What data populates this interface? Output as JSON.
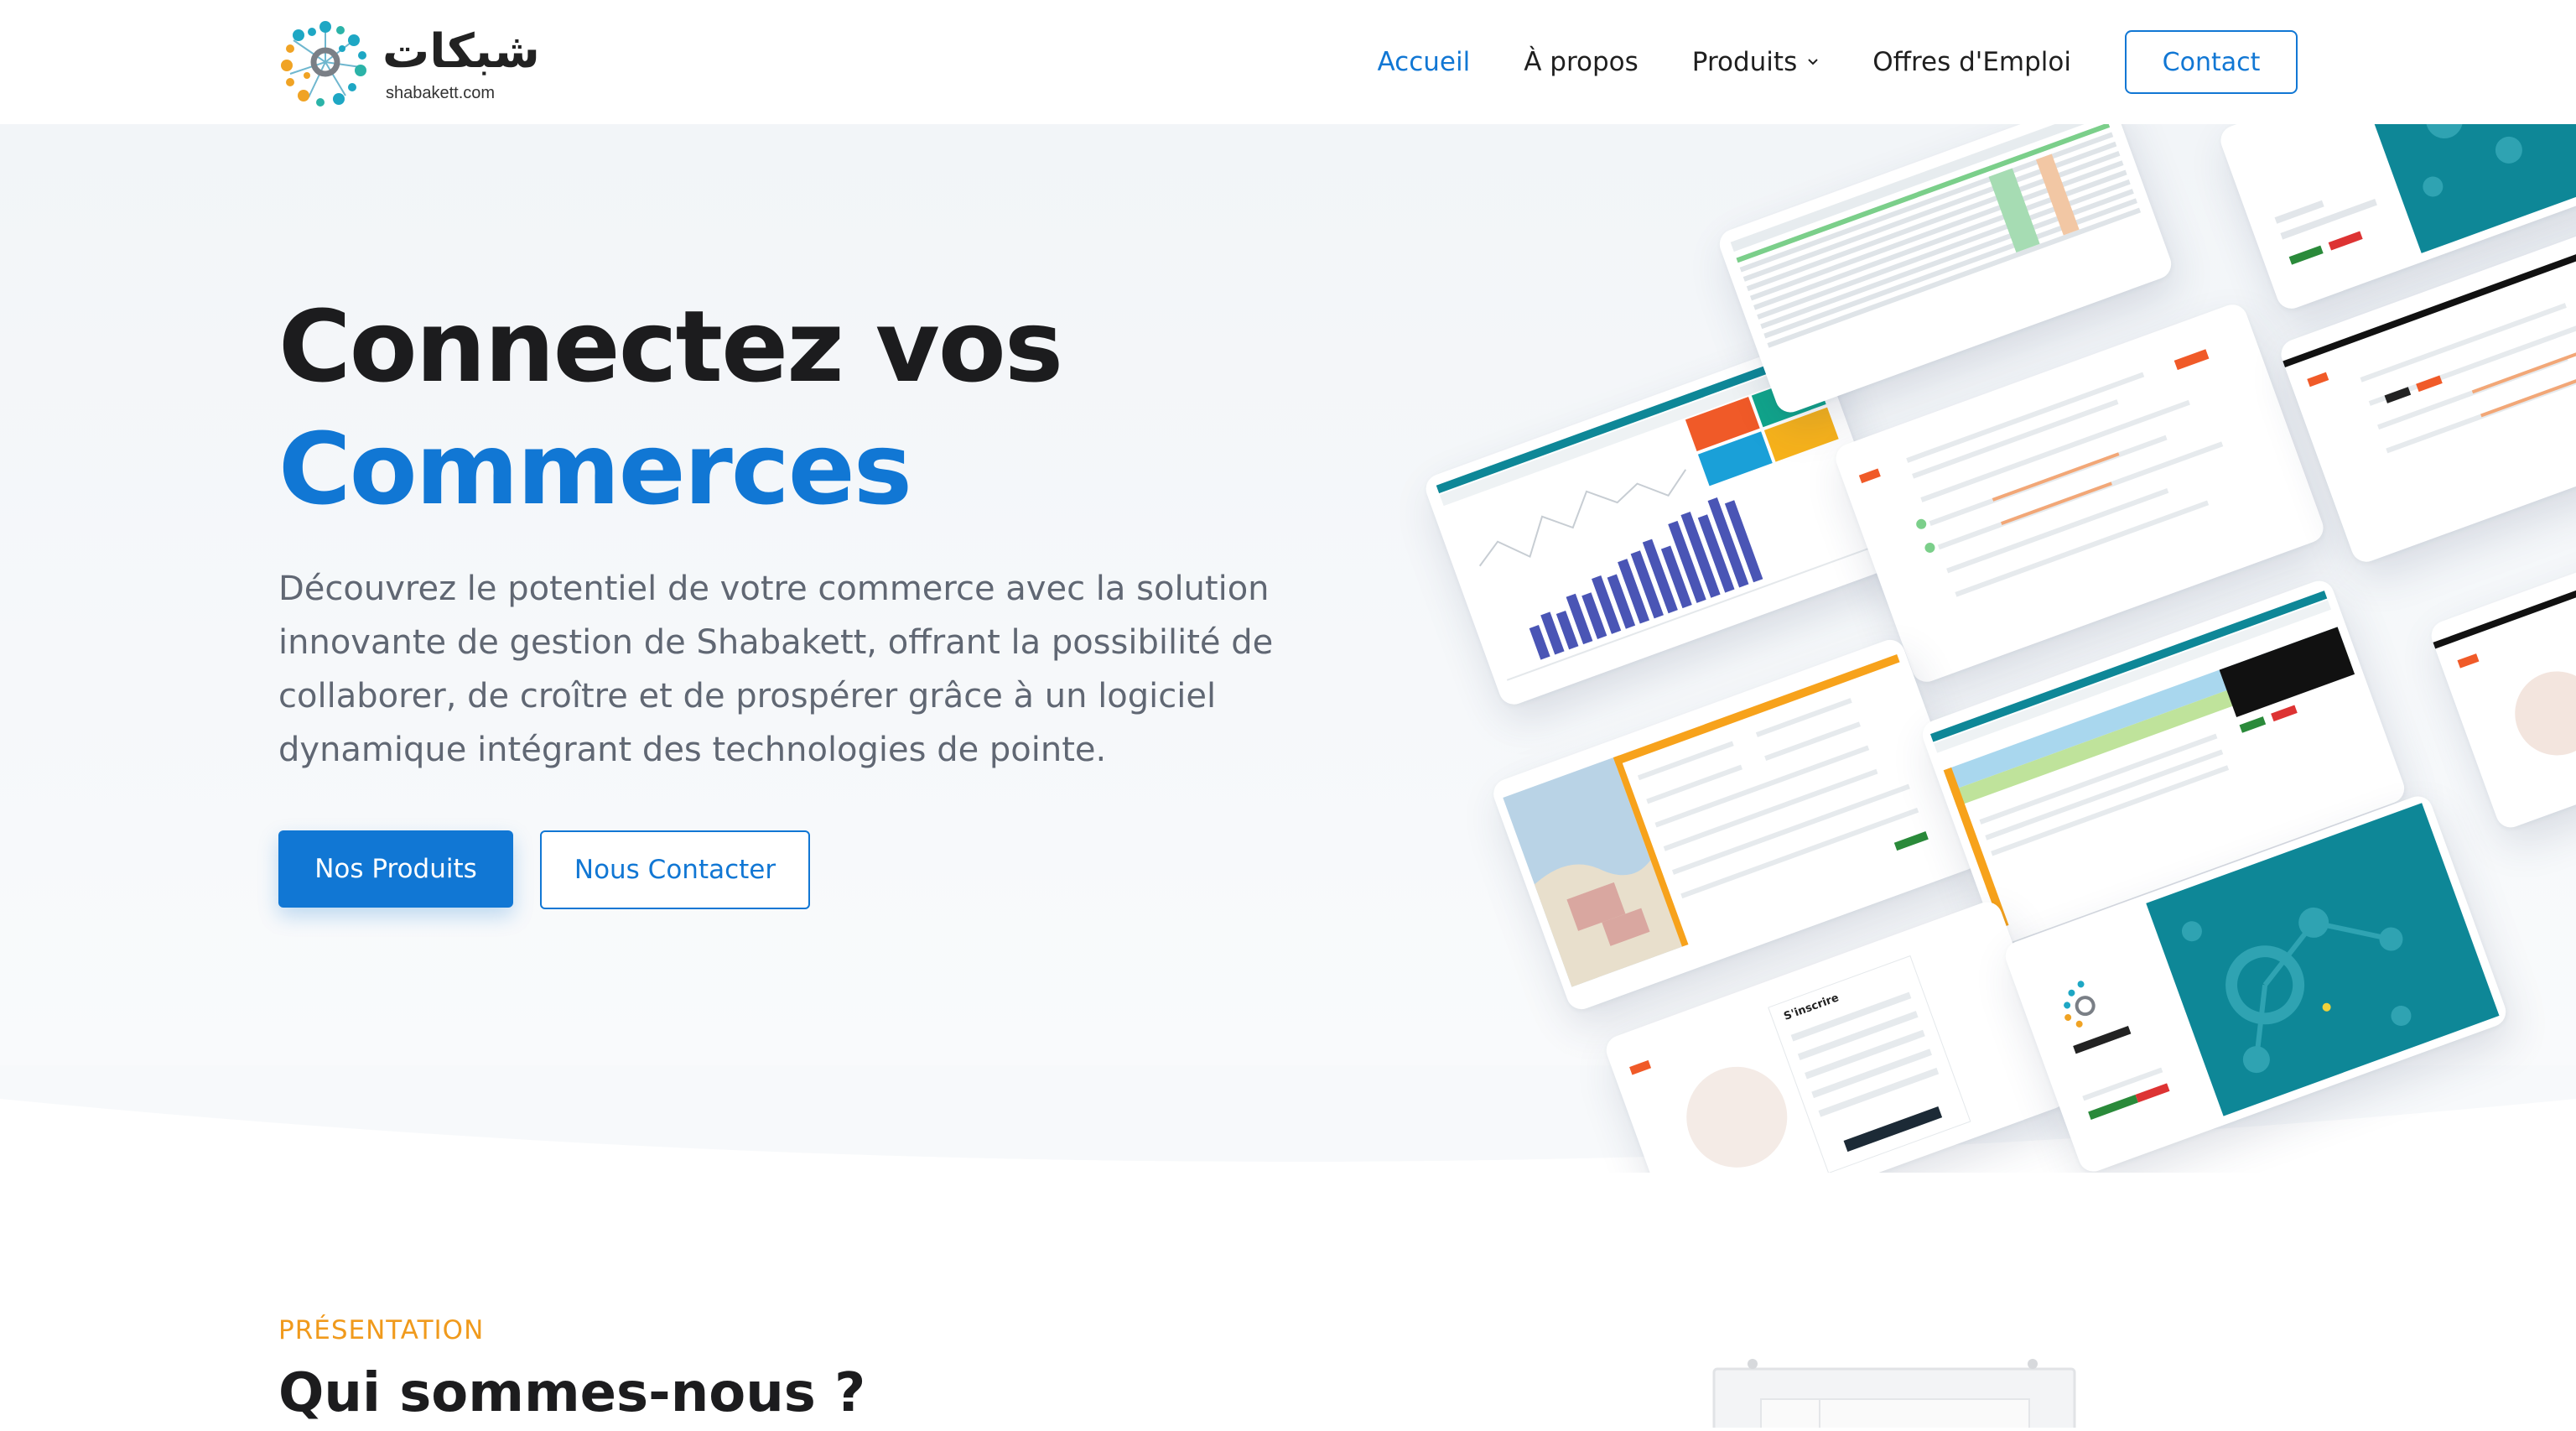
{
  "brand": {
    "arabic_name": "شبكات",
    "domain": "shabakett.com",
    "colors": {
      "primary": "#1177d4",
      "accent": "#f09a1c",
      "teal": "#0e8797",
      "highlight": "#f6dfb8"
    }
  },
  "nav": {
    "items": [
      {
        "label": "Accueil",
        "active": true
      },
      {
        "label": "À propos",
        "active": false
      },
      {
        "label": "Produits",
        "active": false,
        "icon": "chevron-down-icon"
      },
      {
        "label": "Offres d'Emploi",
        "active": false
      }
    ],
    "contact_label": "Contact"
  },
  "hero": {
    "title_line1": "Connectez vos",
    "title_line2": "Commerces",
    "description": "Découvrez le potentiel de votre commerce avec la solution innovante de gestion de Shabakett, offrant la possibilité de collaborer, de croître et de prospérer grâce à un logiciel dynamique intégrant des technologies de pointe.",
    "primary_button": "Nos Produits",
    "secondary_button": "Nous Contacter"
  },
  "collage": {
    "cards": [
      {
        "kind": "dashboard-chart"
      },
      {
        "kind": "data-table"
      },
      {
        "kind": "login-teal"
      },
      {
        "kind": "form-list"
      },
      {
        "kind": "form-list-2"
      },
      {
        "kind": "map-form"
      },
      {
        "kind": "pos-table"
      },
      {
        "kind": "partial-right"
      },
      {
        "kind": "register-form",
        "heading": "S'inscrire"
      },
      {
        "kind": "logo-splash"
      }
    ]
  },
  "presentation": {
    "eyebrow": "PRÉSENTATION",
    "title": "Qui sommes-nous ?"
  }
}
